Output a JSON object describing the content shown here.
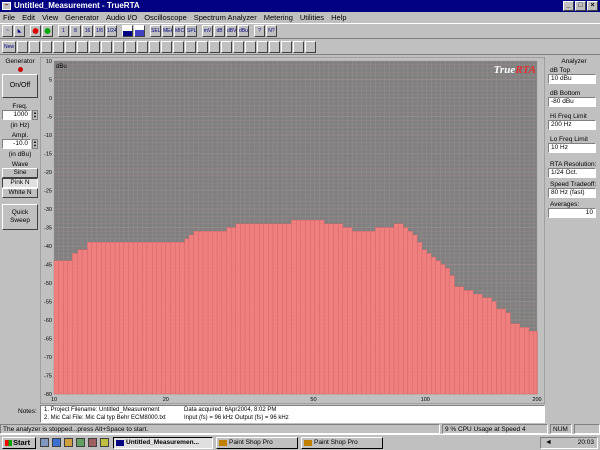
{
  "window": {
    "title": "Untitled_Measurement - TrueRTA",
    "buttons": [
      "_",
      "□",
      "×"
    ]
  },
  "menu": [
    "File",
    "Edit",
    "View",
    "Generator",
    "Audio I/O",
    "Oscilloscope",
    "Spectrum Analyzer",
    "Metering",
    "Utilities",
    "Help"
  ],
  "toolbar": {
    "row1": [
      "~",
      "◣",
      "",
      "",
      "1\nEN",
      "8\nEN",
      "16\nEN",
      "1/6\nEN",
      "1/24\nEN",
      "",
      "SEL",
      "MEAS\nMODE",
      "MIC\nCAL",
      "SPL",
      "mV",
      "dB",
      "dBV",
      "dBu",
      "?",
      "N?"
    ],
    "row2": [
      "New"
    ]
  },
  "generator": {
    "title": "Generator",
    "onoff": "On/Off",
    "freq_label": "Freq.",
    "freq_value": "1000",
    "freq_unit": "(in Hz)",
    "ampl_label": "Ampl.",
    "ampl_value": "-10.0",
    "ampl_unit": "(in dBu)",
    "wave_label": "Wave",
    "waves": [
      "Sine",
      "Pink N",
      "White N"
    ],
    "quick_sweep": "Quick Sweep"
  },
  "analyzer": {
    "title": "Analyzer",
    "db_top_label": "dB Top",
    "db_top_value": "10 dBu",
    "db_bottom_label": "dB Bottom",
    "db_bottom_value": "-80 dBu",
    "hi_freq_label": "Hi Freq Limit",
    "hi_freq_value": "200 Hz",
    "lo_freq_label": "Lo Freq Limit",
    "lo_freq_value": "10 Hz",
    "resolution_label": "RTA Resolution:",
    "resolution_value": "1/24 Oct.",
    "tradeoff_label": "Speed Tradeoff:",
    "tradeoff_value": "80 Hz (fast)",
    "averages_label": "Averages:",
    "averages_value": "10"
  },
  "chart_data": {
    "type": "bar",
    "brand": "TrueRTA",
    "ylabel": "dBu",
    "ylim": [
      -80,
      10
    ],
    "xlim": [
      10,
      200
    ],
    "x_scale": "log",
    "grid": true,
    "y_ticks": [
      10,
      5,
      0,
      -5,
      -10,
      -15,
      -20,
      -25,
      -30,
      -35,
      -40,
      -45,
      -50,
      -55,
      -60,
      -65,
      -70,
      -75,
      -80
    ],
    "x_ticks": [
      10,
      20,
      50,
      100,
      200
    ],
    "colors": {
      "background": "#808080",
      "grid": "#9a9a9a",
      "bars": "#f08080",
      "bar_edge": "#d05a5a"
    },
    "series": [
      {
        "x": [
          10,
          10.3,
          10.6,
          10.9,
          11.2,
          11.6,
          11.9,
          12.3,
          12.6,
          13,
          13.4,
          13.8,
          14.2,
          14.6,
          15,
          15.4,
          15.9,
          16.4,
          16.8,
          17.3,
          17.8,
          18.4,
          18.9,
          19.5,
          20,
          20.6,
          21.2,
          21.8,
          22.5,
          23.1,
          23.8,
          24.5,
          25.2,
          26,
          26.7,
          27.5,
          28.3,
          29.2,
          30,
          30.9,
          31.8,
          32.7,
          33.7,
          34.7,
          35.7,
          36.7,
          37.8,
          38.9,
          40,
          41.2,
          42.4,
          43.6,
          44.9,
          46.2,
          47.6,
          49,
          50.4,
          51.9,
          53.4,
          55,
          56.6,
          58.3,
          60,
          61.8,
          63.6,
          65.4,
          67.3,
          69.3,
          71.3,
          73.4,
          75.5,
          77.8,
          80,
          82.4,
          84.8,
          87.3,
          89.8,
          92.5,
          95.2,
          98,
          100.9,
          103.8,
          106.8,
          110,
          113.2,
          116.5,
          119.9,
          123.4,
          127,
          130.8,
          134.6,
          138.5,
          142.6,
          146.8,
          151.1,
          155.5,
          160.1,
          164.8,
          169.6,
          174.6,
          179.7,
          185,
          190.4,
          196,
          200
        ],
        "y": [
          -44,
          -44,
          -44,
          -44,
          -42,
          -41,
          -41,
          -39,
          -39,
          -39,
          -39,
          -39,
          -39,
          -39,
          -39,
          -39,
          -39,
          -39,
          -39,
          -39,
          -39,
          -39,
          -39,
          -39,
          -39,
          -39,
          -39,
          -39,
          -38,
          -37,
          -36,
          -36,
          -36,
          -36,
          -36,
          -36,
          -36,
          -35,
          -35,
          -34,
          -34,
          -34,
          -34,
          -34,
          -34,
          -34,
          -34,
          -34,
          -34,
          -34,
          -34,
          -33,
          -33,
          -33,
          -33,
          -33,
          -33,
          -33,
          -34,
          -34,
          -34,
          -34,
          -35,
          -35,
          -36,
          -36,
          -36,
          -36,
          -36,
          -35,
          -35,
          -35,
          -35,
          -34,
          -34,
          -35,
          -36,
          -37,
          -39,
          -41,
          -42,
          -43,
          -44,
          -45,
          -46,
          -48,
          -51,
          -51,
          -52,
          -52,
          -53,
          -53,
          -54,
          -54,
          -55,
          -57,
          -57,
          -58,
          -61,
          -61,
          -62,
          -62,
          -63,
          -63,
          -63
        ]
      }
    ]
  },
  "notes": {
    "label": "Notes:",
    "line1_left": "1. Project Filename: Untitled_Measurement",
    "line1_right": "Data acquired: 6Apr2004, 8:02 PM",
    "line2_left": "2. Mic Cal File: Mic Cal typ Behr ECM8000.txt",
    "line2_right": "Input (fs) = 96 kHz     Output (fs) = 96 kHz"
  },
  "status": {
    "main": "The analyzer is stopped...press Alt+Space to start.",
    "cpu": "9 % CPU Usage at Speed 4",
    "num": "NUM"
  },
  "taskbar": {
    "start": "Start",
    "tasks": [
      "Untitled_Measuremen...",
      "Paint Shop Pro",
      "Paint Shop Pro"
    ],
    "clock": "20:03"
  }
}
